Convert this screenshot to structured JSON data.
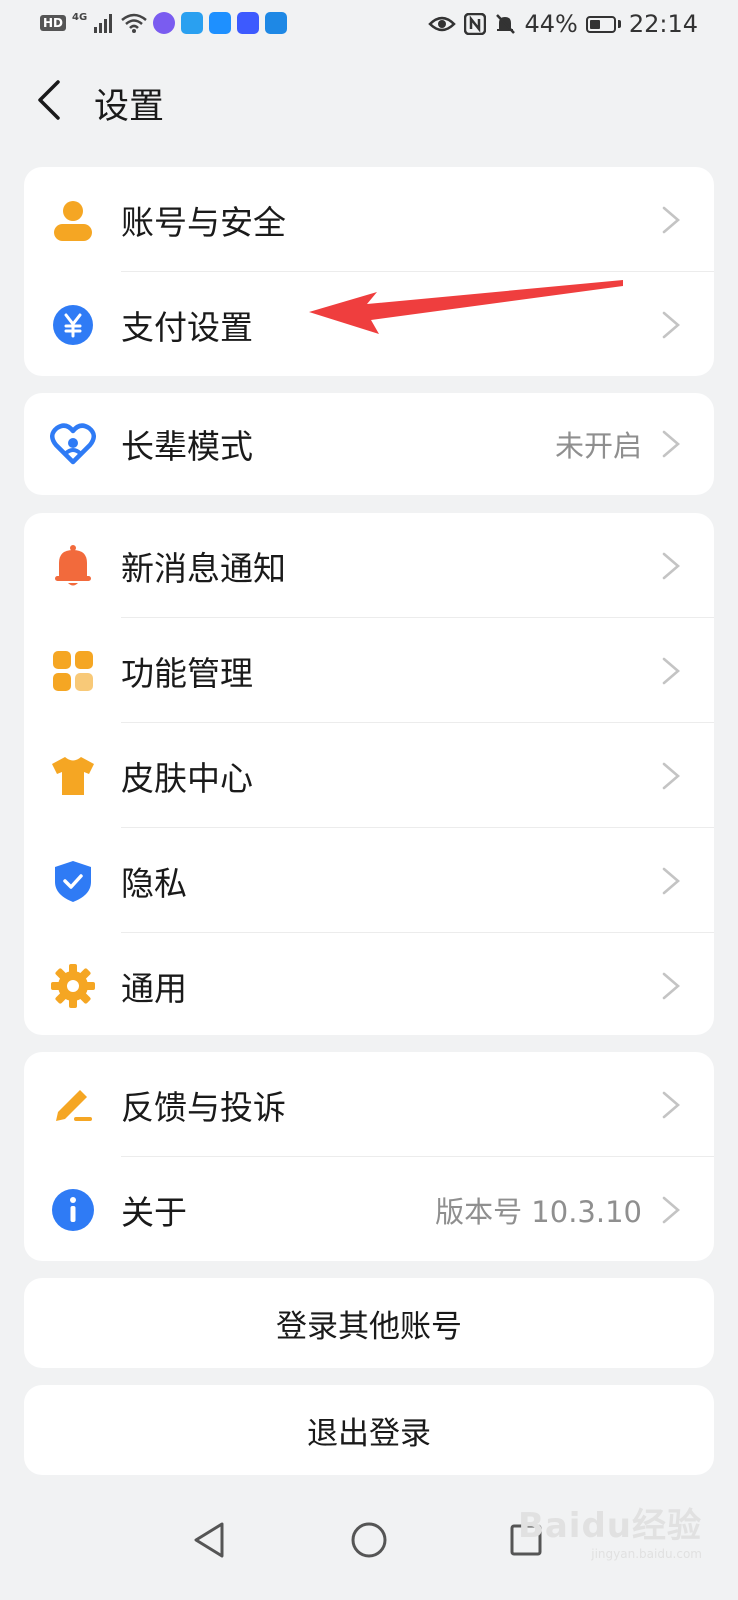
{
  "status_bar": {
    "hd_label": "HD",
    "network_label": "4G",
    "battery_percent": "44%",
    "battery_level": 0.44,
    "time": "22:14"
  },
  "header": {
    "title": "设置"
  },
  "groups": [
    [
      {
        "label": "账号与安全",
        "icon": "user-icon",
        "color": "#f5a623"
      },
      {
        "label": "支付设置",
        "icon": "yuan-icon",
        "color": "#2f7bf5"
      }
    ],
    [
      {
        "label": "长辈模式",
        "icon": "heart-icon",
        "color": "#2f7bf5",
        "value": "未开启"
      }
    ],
    [
      {
        "label": "新消息通知",
        "icon": "bell-icon",
        "color": "#f26a3c"
      },
      {
        "label": "功能管理",
        "icon": "grid-icon",
        "color": "#f5a623"
      },
      {
        "label": "皮肤中心",
        "icon": "shirt-icon",
        "color": "#f5a623"
      },
      {
        "label": "隐私",
        "icon": "shield-icon",
        "color": "#2f7bf5"
      },
      {
        "label": "通用",
        "icon": "gear-icon",
        "color": "#f5a623"
      }
    ],
    [
      {
        "label": "反馈与投诉",
        "icon": "edit-icon",
        "color": "#f5a623"
      },
      {
        "label": "关于",
        "icon": "info-icon",
        "color": "#2f7bf5",
        "value": "版本号 10.3.10"
      }
    ]
  ],
  "buttons": {
    "login_other": "登录其他账号",
    "logout": "退出登录"
  },
  "annotation": {
    "arrow_color": "#ef3e3e"
  },
  "watermark": {
    "brand": "Baidu经验",
    "url": "jingyan.baidu.com"
  }
}
